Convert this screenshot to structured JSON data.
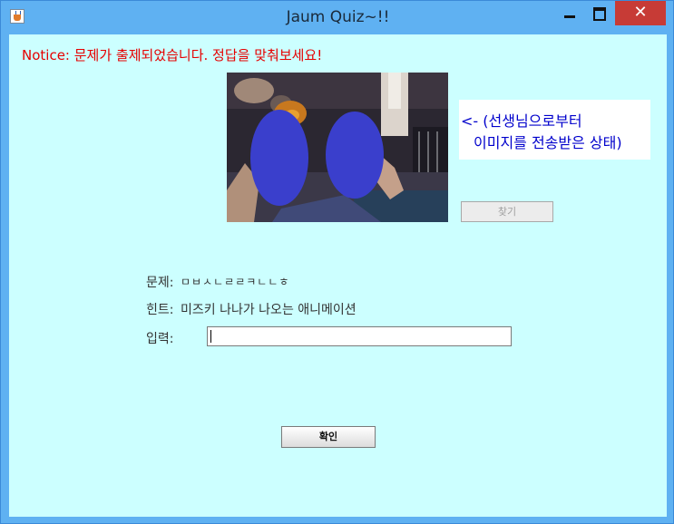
{
  "window": {
    "title": "Jaum Quiz~!!",
    "close_glyph": "✕"
  },
  "notice": "Notice: 문제가 출제되었습니다. 정답을 맞춰보세요!",
  "image_caption": {
    "line1": "<- (선생님으로부터",
    "line2": "이미지를 전송받은 상태)"
  },
  "find_button": {
    "label": "찾기",
    "enabled": false
  },
  "question": {
    "label": "문제:",
    "value": "ㅁㅂㅅㄴㄹㄹㅋㄴㄴㅎ"
  },
  "hint": {
    "label": "힌트:",
    "value": "미즈키 나나가 나오는 애니메이션"
  },
  "answer_input": {
    "label": "입력:",
    "value": "",
    "placeholder": ""
  },
  "confirm_button": {
    "label": "확인"
  },
  "colors": {
    "frame": "#5fb1f2",
    "panel": "#ccffff",
    "notice": "#e60000",
    "caption": "#0000cc",
    "close": "#c73b36",
    "face_mask": "#3a3fcc"
  }
}
